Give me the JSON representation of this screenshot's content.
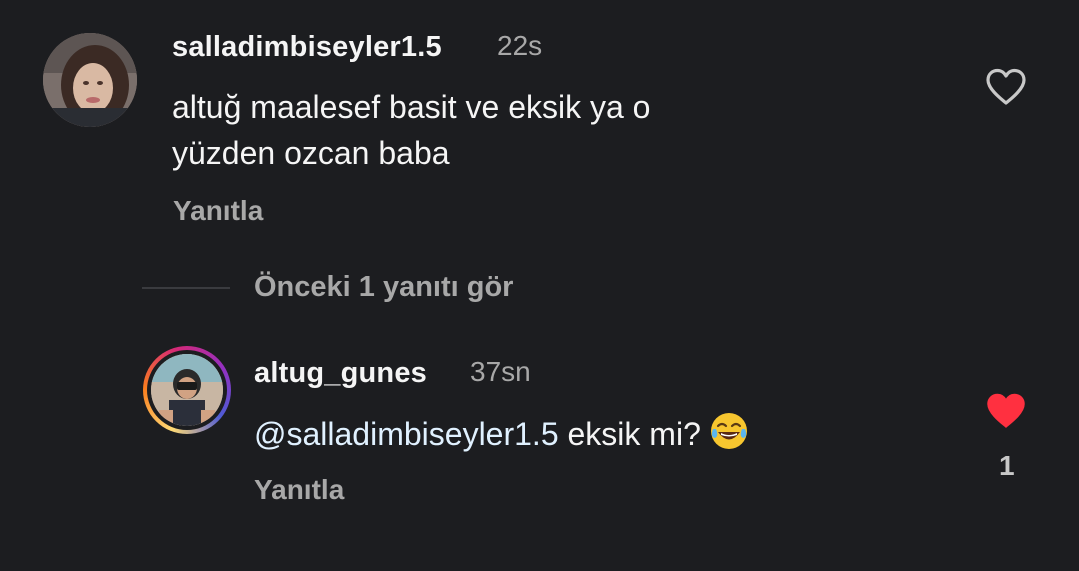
{
  "comments": [
    {
      "username": "salladimbiseyler1.5",
      "time": "22s",
      "text_line1": "altuğ maalesef basit ve eksik ya o",
      "text_line2": "yüzden ozcan baba",
      "reply_label": "Yanıtla",
      "liked": false,
      "like_icon": "heart-outline-icon"
    },
    {
      "username": "altug_gunes",
      "time": "37sn",
      "mention": "@salladimbiseyler1.5",
      "text": " eksik mi?",
      "emoji": "😂",
      "reply_label": "Yanıtla",
      "liked": true,
      "like_icon": "heart-filled-icon",
      "like_count": "1"
    }
  ],
  "view_previous_replies": "Önceki 1 yanıtı gör",
  "colors": {
    "background": "#1c1d20",
    "primary_text": "#f5f5f5",
    "secondary_text": "#a8a8a8",
    "like_red": "#ff3040"
  }
}
